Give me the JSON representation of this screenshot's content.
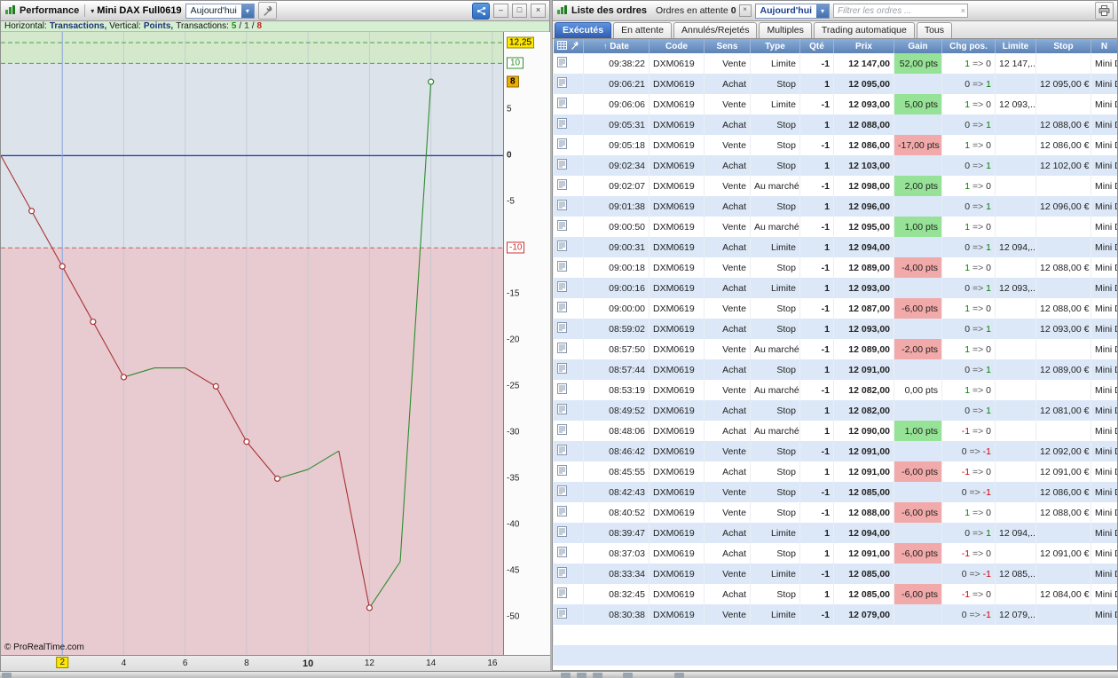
{
  "icons": {
    "caret_down": "▾",
    "minimize": "–",
    "maximize": "□",
    "close": "×",
    "sort_asc": "↑",
    "clear": "×"
  },
  "left_panel": {
    "title": "Performance",
    "instrument": "Mini DAX Full0619",
    "period": "Aujourd'hui",
    "info": {
      "h_label": "Horizontal:",
      "h_value": "Transactions,",
      "v_label": "Vertical:",
      "v_value": "Points,",
      "t_label": "Transactions:",
      "wins": "5",
      "sep": "/",
      "flat": "1",
      "losses": "8"
    },
    "copyright": "© ProRealTime.com"
  },
  "chart_data": {
    "type": "line",
    "title": "Performance",
    "xlabel": "Transactions",
    "ylabel": "Points",
    "x": [
      0,
      1,
      2,
      3,
      4,
      5,
      6,
      7,
      8,
      9,
      10,
      11,
      12,
      13,
      14
    ],
    "values": [
      0,
      -6,
      -12,
      -18,
      -24,
      -23,
      -23,
      -25,
      -31,
      -35,
      -34,
      -32,
      -49,
      -44,
      8
    ],
    "markers": [
      1,
      2,
      3,
      4,
      7,
      8,
      9,
      12,
      14
    ],
    "xlim": [
      0,
      16.35
    ],
    "ylim": [
      -54.1,
      13.4
    ],
    "zero_line": 0,
    "loss_zone_below": -10,
    "green_band_bottom": 10,
    "green_dashed": [
      12.25,
      10
    ],
    "crosshair_x": 2,
    "cursor_y_value_label": "12,25",
    "last_value_label": "8",
    "x_ticks": [
      {
        "v": 2,
        "label": "2",
        "style": "cursor"
      },
      {
        "v": 4,
        "label": "4"
      },
      {
        "v": 6,
        "label": "6"
      },
      {
        "v": 8,
        "label": "8"
      },
      {
        "v": 10,
        "label": "10",
        "style": "bold"
      },
      {
        "v": 12,
        "label": "12"
      },
      {
        "v": 14,
        "label": "14"
      },
      {
        "v": 16,
        "label": "16"
      }
    ],
    "y_ticks": [
      {
        "v": 12.25,
        "label": "12,25",
        "style": "cursor"
      },
      {
        "v": 10,
        "label": "10",
        "style": "green-box"
      },
      {
        "v": 8,
        "label": "8",
        "style": "amber-box"
      },
      {
        "v": 5,
        "label": "5"
      },
      {
        "v": 0,
        "label": "0",
        "style": "bold"
      },
      {
        "v": -5,
        "label": "-5"
      },
      {
        "v": -10,
        "label": "-10",
        "style": "red-box"
      },
      {
        "v": -15,
        "label": "-15"
      },
      {
        "v": -20,
        "label": "-20"
      },
      {
        "v": -25,
        "label": "-25"
      },
      {
        "v": -30,
        "label": "-30"
      },
      {
        "v": -35,
        "label": "-35"
      },
      {
        "v": -40,
        "label": "-40"
      },
      {
        "v": -45,
        "label": "-45"
      },
      {
        "v": -50,
        "label": "-50"
      }
    ],
    "colors": {
      "bg_upper": "#dde3eb",
      "bg_band": "#d4e9cc",
      "bg_loss": "#e8cbd1",
      "grid": "#bac4cf",
      "zero": "#2233aa",
      "crosshair": "#8ea6de",
      "green_line": "#4d9e4d",
      "red_line": "#c86060",
      "series_up": "#2c8c2c",
      "series_down": "#a83232"
    }
  },
  "right_panel": {
    "title": "Liste des ordres",
    "pending_label": "Ordres en attente",
    "pending_count": "0",
    "period": "Aujourd'hui",
    "filter_placeholder": "Filtrer les ordres ...",
    "tabs": [
      {
        "key": "executes",
        "label": "Exécutés",
        "active": true
      },
      {
        "key": "en-attente",
        "label": "En attente"
      },
      {
        "key": "annules-rejetes",
        "label": "Annulés/Rejetés"
      },
      {
        "key": "multiples",
        "label": "Multiples"
      },
      {
        "key": "trading-automatique",
        "label": "Trading automatique"
      },
      {
        "key": "tous",
        "label": "Tous"
      }
    ],
    "table": {
      "columns": [
        {
          "key": "date",
          "label": "Date",
          "sort": true
        },
        {
          "key": "code",
          "label": "Code"
        },
        {
          "key": "sens",
          "label": "Sens"
        },
        {
          "key": "type",
          "label": "Type"
        },
        {
          "key": "qte",
          "label": "Qté"
        },
        {
          "key": "prix",
          "label": "Prix"
        },
        {
          "key": "gain",
          "label": "Gain"
        },
        {
          "key": "chg",
          "label": "Chg pos."
        },
        {
          "key": "limite",
          "label": "Limite"
        },
        {
          "key": "stop",
          "label": "Stop"
        },
        {
          "key": "nom",
          "label": "N"
        }
      ],
      "rows": [
        {
          "date": "09:38:22",
          "code": "DXM0619",
          "sens": "Vente",
          "type": "Limite",
          "qte": "-1",
          "prix": "12 147,00",
          "gain": "52,00 pts",
          "chg": "1 => 0",
          "limite": "12 147,...",
          "stop": "",
          "nom": "Mini D"
        },
        {
          "date": "09:06:21",
          "code": "DXM0619",
          "sens": "Achat",
          "type": "Stop",
          "qte": "1",
          "prix": "12 095,00",
          "gain": "",
          "chg": "0 => 1",
          "limite": "",
          "stop": "12 095,00 €",
          "nom": "Mini D"
        },
        {
          "date": "09:06:06",
          "code": "DXM0619",
          "sens": "Vente",
          "type": "Limite",
          "qte": "-1",
          "prix": "12 093,00",
          "gain": "5,00 pts",
          "chg": "1 => 0",
          "limite": "12 093,...",
          "stop": "",
          "nom": "Mini D"
        },
        {
          "date": "09:05:31",
          "code": "DXM0619",
          "sens": "Achat",
          "type": "Stop",
          "qte": "1",
          "prix": "12 088,00",
          "gain": "",
          "chg": "0 => 1",
          "limite": "",
          "stop": "12 088,00 €",
          "nom": "Mini D"
        },
        {
          "date": "09:05:18",
          "code": "DXM0619",
          "sens": "Vente",
          "type": "Stop",
          "qte": "-1",
          "prix": "12 086,00",
          "gain": "-17,00 pts",
          "chg": "1 => 0",
          "limite": "",
          "stop": "12 086,00 €",
          "nom": "Mini D"
        },
        {
          "date": "09:02:34",
          "code": "DXM0619",
          "sens": "Achat",
          "type": "Stop",
          "qte": "1",
          "prix": "12 103,00",
          "gain": "",
          "chg": "0 => 1",
          "limite": "",
          "stop": "12 102,00 €",
          "nom": "Mini D"
        },
        {
          "date": "09:02:07",
          "code": "DXM0619",
          "sens": "Vente",
          "type": "Au marché",
          "qte": "-1",
          "prix": "12 098,00",
          "gain": "2,00 pts",
          "chg": "1 => 0",
          "limite": "",
          "stop": "",
          "nom": "Mini D"
        },
        {
          "date": "09:01:38",
          "code": "DXM0619",
          "sens": "Achat",
          "type": "Stop",
          "qte": "1",
          "prix": "12 096,00",
          "gain": "",
          "chg": "0 => 1",
          "limite": "",
          "stop": "12 096,00 €",
          "nom": "Mini D"
        },
        {
          "date": "09:00:50",
          "code": "DXM0619",
          "sens": "Vente",
          "type": "Au marché",
          "qte": "-1",
          "prix": "12 095,00",
          "gain": "1,00 pts",
          "chg": "1 => 0",
          "limite": "",
          "stop": "",
          "nom": "Mini D"
        },
        {
          "date": "09:00:31",
          "code": "DXM0619",
          "sens": "Achat",
          "type": "Limite",
          "qte": "1",
          "prix": "12 094,00",
          "gain": "",
          "chg": "0 => 1",
          "limite": "12 094,...",
          "stop": "",
          "nom": "Mini D"
        },
        {
          "date": "09:00:18",
          "code": "DXM0619",
          "sens": "Vente",
          "type": "Stop",
          "qte": "-1",
          "prix": "12 089,00",
          "gain": "-4,00 pts",
          "chg": "1 => 0",
          "limite": "",
          "stop": "12 088,00 €",
          "nom": "Mini D"
        },
        {
          "date": "09:00:16",
          "code": "DXM0619",
          "sens": "Achat",
          "type": "Limite",
          "qte": "1",
          "prix": "12 093,00",
          "gain": "",
          "chg": "0 => 1",
          "limite": "12 093,...",
          "stop": "",
          "nom": "Mini D"
        },
        {
          "date": "09:00:00",
          "code": "DXM0619",
          "sens": "Vente",
          "type": "Stop",
          "qte": "-1",
          "prix": "12 087,00",
          "gain": "-6,00 pts",
          "chg": "1 => 0",
          "limite": "",
          "stop": "12 088,00 €",
          "nom": "Mini D"
        },
        {
          "date": "08:59:02",
          "code": "DXM0619",
          "sens": "Achat",
          "type": "Stop",
          "qte": "1",
          "prix": "12 093,00",
          "gain": "",
          "chg": "0 => 1",
          "limite": "",
          "stop": "12 093,00 €",
          "nom": "Mini D"
        },
        {
          "date": "08:57:50",
          "code": "DXM0619",
          "sens": "Vente",
          "type": "Au marché",
          "qte": "-1",
          "prix": "12 089,00",
          "gain": "-2,00 pts",
          "chg": "1 => 0",
          "limite": "",
          "stop": "",
          "nom": "Mini D"
        },
        {
          "date": "08:57:44",
          "code": "DXM0619",
          "sens": "Achat",
          "type": "Stop",
          "qte": "1",
          "prix": "12 091,00",
          "gain": "",
          "chg": "0 => 1",
          "limite": "",
          "stop": "12 089,00 €",
          "nom": "Mini D"
        },
        {
          "date": "08:53:19",
          "code": "DXM0619",
          "sens": "Vente",
          "type": "Au marché",
          "qte": "-1",
          "prix": "12 082,00",
          "gain": "0,00 pts",
          "chg": "1 => 0",
          "limite": "",
          "stop": "",
          "nom": "Mini D"
        },
        {
          "date": "08:49:52",
          "code": "DXM0619",
          "sens": "Achat",
          "type": "Stop",
          "qte": "1",
          "prix": "12 082,00",
          "gain": "",
          "chg": "0 => 1",
          "limite": "",
          "stop": "12 081,00 €",
          "nom": "Mini D"
        },
        {
          "date": "08:48:06",
          "code": "DXM0619",
          "sens": "Achat",
          "type": "Au marché",
          "qte": "1",
          "prix": "12 090,00",
          "gain": "1,00 pts",
          "chg": "-1 => 0",
          "limite": "",
          "stop": "",
          "nom": "Mini D"
        },
        {
          "date": "08:46:42",
          "code": "DXM0619",
          "sens": "Vente",
          "type": "Stop",
          "qte": "-1",
          "prix": "12 091,00",
          "gain": "",
          "chg": "0 => -1",
          "limite": "",
          "stop": "12 092,00 €",
          "nom": "Mini D"
        },
        {
          "date": "08:45:55",
          "code": "DXM0619",
          "sens": "Achat",
          "type": "Stop",
          "qte": "1",
          "prix": "12 091,00",
          "gain": "-6,00 pts",
          "chg": "-1 => 0",
          "limite": "",
          "stop": "12 091,00 €",
          "nom": "Mini D"
        },
        {
          "date": "08:42:43",
          "code": "DXM0619",
          "sens": "Vente",
          "type": "Stop",
          "qte": "-1",
          "prix": "12 085,00",
          "gain": "",
          "chg": "0 => -1",
          "limite": "",
          "stop": "12 086,00 €",
          "nom": "Mini D"
        },
        {
          "date": "08:40:52",
          "code": "DXM0619",
          "sens": "Vente",
          "type": "Stop",
          "qte": "-1",
          "prix": "12 088,00",
          "gain": "-6,00 pts",
          "chg": "1 => 0",
          "limite": "",
          "stop": "12 088,00 €",
          "nom": "Mini D"
        },
        {
          "date": "08:39:47",
          "code": "DXM0619",
          "sens": "Achat",
          "type": "Limite",
          "qte": "1",
          "prix": "12 094,00",
          "gain": "",
          "chg": "0 => 1",
          "limite": "12 094,...",
          "stop": "",
          "nom": "Mini D"
        },
        {
          "date": "08:37:03",
          "code": "DXM0619",
          "sens": "Achat",
          "type": "Stop",
          "qte": "1",
          "prix": "12 091,00",
          "gain": "-6,00 pts",
          "chg": "-1 => 0",
          "limite": "",
          "stop": "12 091,00 €",
          "nom": "Mini D"
        },
        {
          "date": "08:33:34",
          "code": "DXM0619",
          "sens": "Vente",
          "type": "Limite",
          "qte": "-1",
          "prix": "12 085,00",
          "gain": "",
          "chg": "0 => -1",
          "limite": "12 085,...",
          "stop": "",
          "nom": "Mini D"
        },
        {
          "date": "08:32:45",
          "code": "DXM0619",
          "sens": "Achat",
          "type": "Stop",
          "qte": "1",
          "prix": "12 085,00",
          "gain": "-6,00 pts",
          "chg": "-1 => 0",
          "limite": "",
          "stop": "12 084,00 €",
          "nom": "Mini D"
        },
        {
          "date": "08:30:38",
          "code": "DXM0619",
          "sens": "Vente",
          "type": "Limite",
          "qte": "-1",
          "prix": "12 079,00",
          "gain": "",
          "chg": "0 => -1",
          "limite": "12 079,...",
          "stop": "",
          "nom": "Mini D"
        }
      ]
    }
  }
}
